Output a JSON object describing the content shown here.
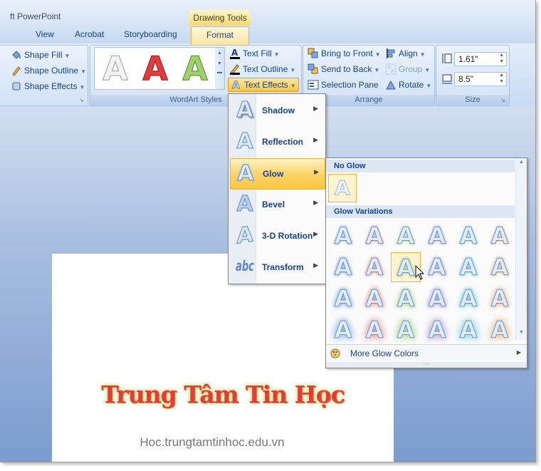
{
  "app": {
    "title": "Microsoft PowerPoint",
    "title_visible": "ft PowerPoint",
    "context_tools": "Drawing Tools"
  },
  "tabs": [
    "View",
    "Acrobat",
    "Storyboarding",
    "Format"
  ],
  "active_tab": "Format",
  "ribbon": {
    "shape_group": {
      "shape_fill": "Shape Fill",
      "shape_outline": "Shape Outline",
      "shape_effects": "Shape Effects"
    },
    "wordart": {
      "label": "WordArt Styles",
      "text_fill": "Text Fill",
      "text_outline": "Text Outline",
      "text_effects": "Text Effects",
      "gallery_colors": [
        "#f2f2f2",
        "#e23b3b",
        "#9fd26b"
      ]
    },
    "arrange": {
      "label": "Arrange",
      "bring_to_front": "Bring to Front",
      "send_to_back": "Send to Back",
      "selection_pane": "Selection Pane",
      "align": "Align",
      "group": "Group",
      "rotate": "Rotate"
    },
    "size": {
      "label": "Size",
      "height": "1.61\"",
      "width": "8.5\""
    }
  },
  "text_effects_menu": [
    {
      "label": "Shadow",
      "icon": "shadow-a-icon"
    },
    {
      "label": "Reflection",
      "icon": "reflection-a-icon"
    },
    {
      "label": "Glow",
      "icon": "glow-a-icon"
    },
    {
      "label": "Bevel",
      "icon": "bevel-a-icon"
    },
    {
      "label": "3-D Rotation",
      "icon": "rotation-a-icon"
    },
    {
      "label": "Transform",
      "icon": "transform-abc-icon"
    }
  ],
  "glow_panel": {
    "no_glow": "No Glow",
    "variations": "Glow Variations",
    "more_colors": "More Glow Colors",
    "glow_colors": [
      "#8db4e2",
      "#e89898",
      "#a9d98a",
      "#b9a2d6",
      "#7fd0e4",
      "#f3b784"
    ],
    "rows": 4,
    "selected": {
      "row": 2,
      "col": 3
    }
  },
  "slide": {
    "wordart_text": "Trung Tâm Tin Học",
    "watermark": "Hoc.trungtamtinhoc.edu.vn"
  }
}
